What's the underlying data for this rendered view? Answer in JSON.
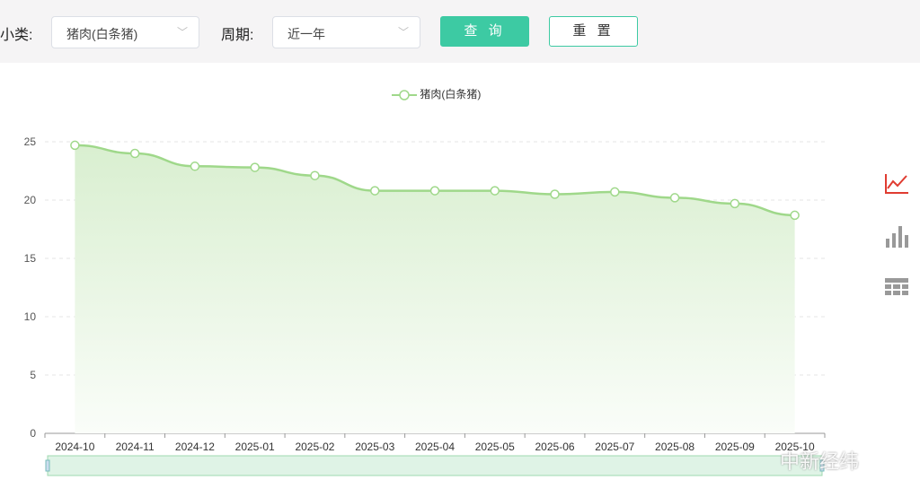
{
  "filters": {
    "category_label": "小类:",
    "category_value": "猪肉(白条猪)",
    "period_label": "周期:",
    "period_value": "近一年",
    "query_button": "查 询",
    "reset_button": "重 置"
  },
  "colors": {
    "accent": "#3dcaa3",
    "line": "#9fd88a"
  },
  "watermark": "中新经纬",
  "chart_data": {
    "type": "area",
    "legend": [
      "猪肉(白条猪)"
    ],
    "legend_position": "top-center",
    "categories": [
      "2024-10",
      "2024-11",
      "2024-12",
      "2025-01",
      "2025-02",
      "2025-03",
      "2025-04",
      "2025-05",
      "2025-06",
      "2025-07",
      "2025-08",
      "2025-09",
      "2025-10"
    ],
    "series": [
      {
        "name": "猪肉(白条猪)",
        "values": [
          24.7,
          24.0,
          22.9,
          22.8,
          22.1,
          20.8,
          20.8,
          20.8,
          20.5,
          20.7,
          20.2,
          19.7,
          18.7
        ]
      }
    ],
    "ylim": [
      0,
      25
    ],
    "yticks": [
      0,
      5,
      10,
      15,
      20,
      25
    ],
    "grid": true
  }
}
